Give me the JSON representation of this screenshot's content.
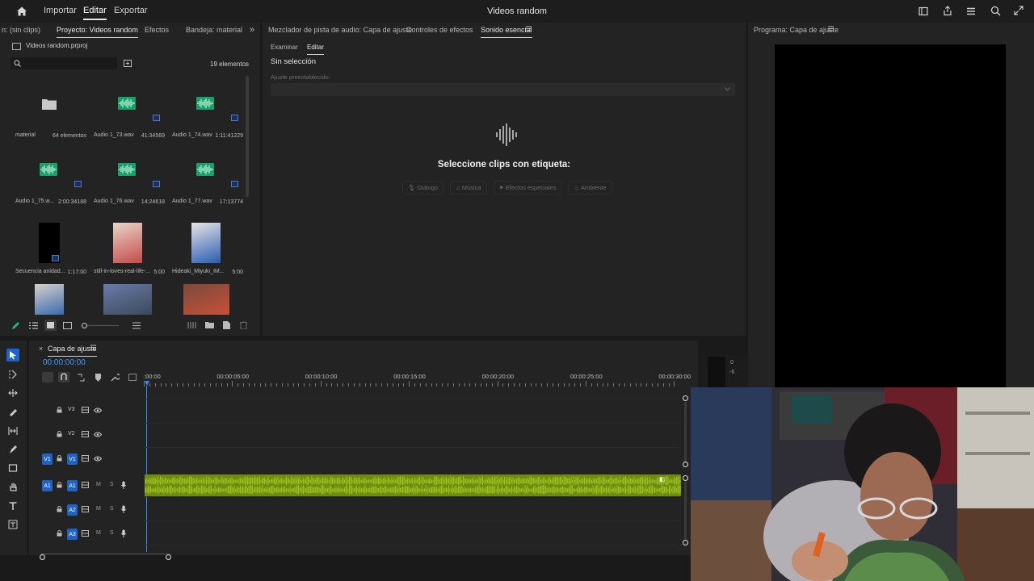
{
  "topbar": {
    "home_icon": "home-icon",
    "menus": [
      "Importar",
      "Editar",
      "Exportar"
    ],
    "title": "Videos random",
    "right_icons": [
      "workspace-icon",
      "share-icon",
      "menu-icon",
      "search-icon",
      "expand-icon"
    ]
  },
  "project_panel": {
    "tabs": [
      "n: (sin clips)",
      "Proyecto: Videos random",
      "Efectos",
      "Bandeja: material"
    ],
    "file_name": "Videos random.prproj",
    "item_count": "19 elementos",
    "search_placeholder": "",
    "items": [
      {
        "name": "material",
        "meta": "64 elementos",
        "kind": "folder"
      },
      {
        "name": "Audio 1_73.wav",
        "meta": "41:34569",
        "kind": "audio"
      },
      {
        "name": "Audio 1_74.wav",
        "meta": "1:11:41229",
        "kind": "audio"
      },
      {
        "name": "Audio 1_75.w...",
        "meta": "2:00:34188",
        "kind": "audio"
      },
      {
        "name": "Audio 1_76.wav",
        "meta": "14:24618",
        "kind": "audio"
      },
      {
        "name": "Audio 1_77.wav",
        "meta": "17:13774",
        "kind": "audio"
      },
      {
        "name": "Secuencia anidad...",
        "meta": "1:17:00",
        "kind": "sequence"
      },
      {
        "name": "still-in-loves-real-life-...",
        "meta": "5:00",
        "kind": "image"
      },
      {
        "name": "Hideaki_Miyuki_IM...",
        "meta": "5:00",
        "kind": "image"
      },
      {
        "name": "",
        "meta": "",
        "kind": "image"
      },
      {
        "name": "",
        "meta": "",
        "kind": "image"
      },
      {
        "name": "",
        "meta": "",
        "kind": "image"
      }
    ]
  },
  "essential_sound": {
    "tabs": [
      "Mezclador de pista de audio: Capa de ajuste",
      "Controles de efectos",
      "Sonido esencial"
    ],
    "subtabs": [
      "Examinar",
      "Editar"
    ],
    "no_selection": "Sin selección",
    "preset_label": "Ajuste preestablecido:",
    "prompt": "Seleccione clips con etiqueta:",
    "types": [
      "Diálogo",
      "Música",
      "Efectos especiales",
      "Ambiente"
    ]
  },
  "program_monitor": {
    "title": "Programa: Capa de ajuste"
  },
  "timeline": {
    "sequence_name": "Capa de ajuste",
    "timecode": "00:00:00:00",
    "ruler": [
      ":00:00",
      "00:00:05:00",
      "00:00:10:00",
      "00:00:15:00",
      "00:00:20:00",
      "00:00:25:00",
      "00:00:30:00"
    ],
    "video_tracks": [
      "V3",
      "V2",
      "V1"
    ],
    "audio_tracks": [
      "A1",
      "A2",
      "A3"
    ],
    "source_v": "V1",
    "source_a": "A1",
    "track_m": "M",
    "track_s": "S",
    "meter_labels": [
      "0",
      "-6"
    ],
    "audio_clip_color": "#9bc11a"
  },
  "tools": [
    "selection-tool-icon",
    "track-select-icon",
    "ripple-edit-icon",
    "razor-icon",
    "slip-icon",
    "pen-icon",
    "rectangle-icon",
    "hand-icon",
    "type-icon",
    "captions-icon"
  ],
  "colors": {
    "accent": "#1e63c7",
    "playhead": "#2f8cff",
    "audio_wave": "#1aa06a"
  }
}
